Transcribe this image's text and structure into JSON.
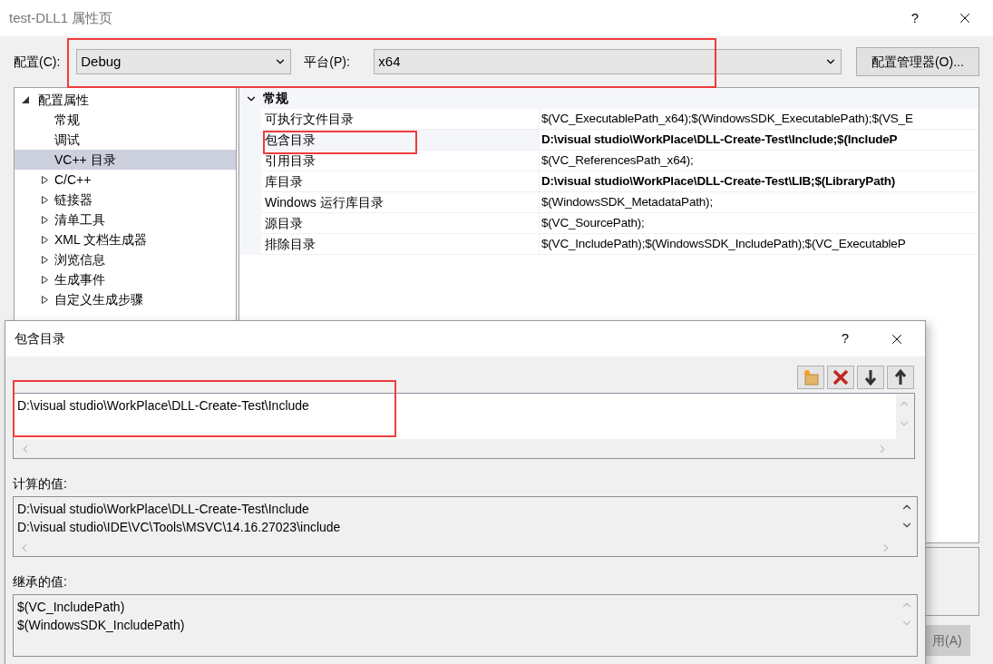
{
  "window": {
    "title": "test-DLL1 属性页",
    "help": "?"
  },
  "config": {
    "label": "配置(C):",
    "value": "Debug"
  },
  "platform": {
    "label": "平台(P):",
    "value": "x64"
  },
  "config_manager_button": "配置管理器(O)...",
  "tree": [
    {
      "label": "配置属性",
      "expanded": true,
      "children": [
        {
          "label": "常规",
          "kind": "leaf",
          "selected": false
        },
        {
          "label": "调试",
          "kind": "leaf",
          "selected": false
        },
        {
          "label": "VC++ 目录",
          "kind": "leaf",
          "selected": true
        },
        {
          "label": "C/C++",
          "kind": "group",
          "selected": false,
          "expanded": false
        },
        {
          "label": "链接器",
          "kind": "group",
          "selected": false,
          "expanded": false
        },
        {
          "label": "清单工具",
          "kind": "group",
          "selected": false,
          "expanded": false
        },
        {
          "label": "XML 文档生成器",
          "kind": "group",
          "selected": false,
          "expanded": false
        },
        {
          "label": "浏览信息",
          "kind": "group",
          "selected": false,
          "expanded": false
        },
        {
          "label": "生成事件",
          "kind": "group",
          "selected": false,
          "expanded": false
        },
        {
          "label": "自定义生成步骤",
          "kind": "group",
          "selected": false,
          "expanded": false
        }
      ]
    }
  ],
  "grid": {
    "category": "常规",
    "expanded": true,
    "rows": [
      {
        "name": "可执行文件目录",
        "value": "$(VC_ExecutablePath_x64);$(WindowsSDK_ExecutablePath);$(VS_E",
        "bold": false,
        "selected": false
      },
      {
        "name": "包含目录",
        "value": "D:\\visual studio\\WorkPlace\\DLL-Create-Test\\Include;$(IncludeP",
        "bold": true,
        "selected": true
      },
      {
        "name": "引用目录",
        "value": "$(VC_ReferencesPath_x64);",
        "bold": false,
        "selected": false
      },
      {
        "name": "库目录",
        "value": "D:\\visual studio\\WorkPlace\\DLL-Create-Test\\LIB;$(LibraryPath)",
        "bold": true,
        "selected": false
      },
      {
        "name": "Windows 运行库目录",
        "value": "$(WindowsSDK_MetadataPath);",
        "bold": false,
        "selected": false
      },
      {
        "name": "源目录",
        "value": "$(VC_SourcePath);",
        "bold": false,
        "selected": false
      },
      {
        "name": "排除目录",
        "value": "$(VC_IncludePath);$(WindowsSDK_IncludePath);$(VC_ExecutableP",
        "bold": false,
        "selected": false
      }
    ]
  },
  "apply_button": "用(A)",
  "dialog": {
    "title": "包含目录",
    "help": "?",
    "toolbar": [
      {
        "kind": "new-folder"
      },
      {
        "kind": "delete"
      },
      {
        "kind": "move-down"
      },
      {
        "kind": "move-up"
      }
    ],
    "edit_lines": [
      "D:\\visual studio\\WorkPlace\\DLL-Create-Test\\Include"
    ],
    "computed_label": "计算的值:",
    "computed_lines": [
      "D:\\visual studio\\WorkPlace\\DLL-Create-Test\\Include",
      "D:\\visual studio\\IDE\\VC\\Tools\\MSVC\\14.16.27023\\include"
    ],
    "inherited_label": "继承的值:",
    "inherited_lines": [
      "$(VC_IncludePath)",
      "$(WindowsSDK_IncludePath)"
    ]
  }
}
